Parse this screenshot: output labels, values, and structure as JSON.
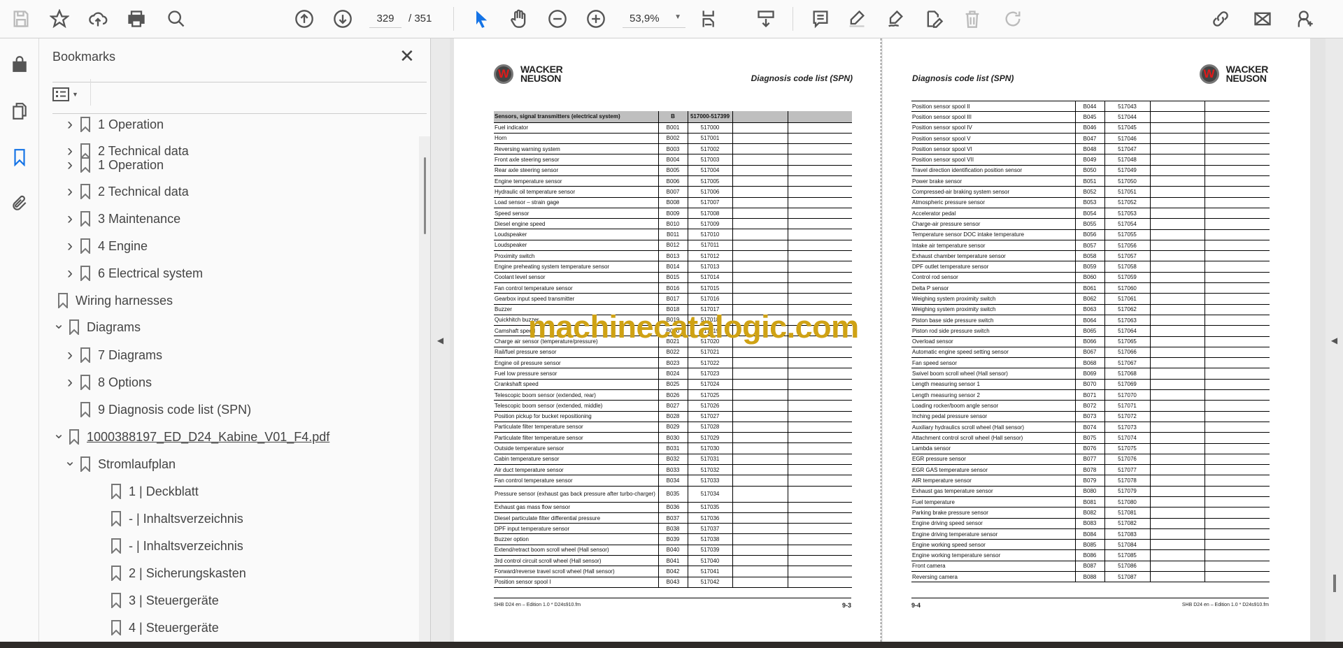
{
  "toolbar": {
    "page_current": "329",
    "page_total": "/ 351",
    "zoom": "53,9%",
    "icons": [
      "save-icon",
      "bookmark-star-icon",
      "upload-cloud-icon",
      "print-icon",
      "find-icon",
      "page-up-icon",
      "page-down-icon",
      "select-pointer-icon",
      "hand-icon",
      "zoom-out-icon",
      "zoom-in-icon",
      "fit-page-icon",
      "scroll-mode-icon",
      "comment-icon",
      "highlight-icon",
      "sign-icon",
      "edit-pdf-icon",
      "delete-icon",
      "rotate-icon",
      "share-link-icon",
      "email-icon",
      "add-user-icon"
    ]
  },
  "sidebar": {
    "title": "Bookmarks",
    "items": [
      {
        "label": "1 Operation",
        "level": 1,
        "state": "collapsed"
      },
      {
        "label": "2 Technical data",
        "level": 1,
        "state": "collapsed"
      },
      {
        "label": "1 Operation",
        "level": 1,
        "state": "collapsed"
      },
      {
        "label": "2 Technical data",
        "level": 1,
        "state": "collapsed"
      },
      {
        "label": "3 Maintenance",
        "level": 1,
        "state": "collapsed"
      },
      {
        "label": "4 Engine",
        "level": 1,
        "state": "collapsed"
      },
      {
        "label": "6 Electrical system",
        "level": 1,
        "state": "collapsed"
      },
      {
        "label": "Wiring harnesses",
        "level": 0,
        "state": "leaf"
      },
      {
        "label": "Diagrams",
        "level": 0,
        "state": "expanded"
      },
      {
        "label": "7 Diagrams",
        "level": 1,
        "state": "collapsed"
      },
      {
        "label": "8 Options",
        "level": 1,
        "state": "collapsed"
      },
      {
        "label": "9 Diagnosis code list (SPN)",
        "level": 1,
        "state": "leaf"
      },
      {
        "label": "1000388197_ED_D24_Kabine_V01_F4.pdf",
        "level": 0,
        "state": "expanded",
        "link": true
      },
      {
        "label": "Stromlaufplan",
        "level": 1,
        "state": "expanded"
      },
      {
        "label": "1 | Deckblatt",
        "level": 2,
        "state": "leaf"
      },
      {
        "label": "- | Inhaltsverzeichnis",
        "level": 2,
        "state": "leaf"
      },
      {
        "label": "- | Inhaltsverzeichnis",
        "level": 2,
        "state": "leaf"
      },
      {
        "label": "2 | Sicherungskasten",
        "level": 2,
        "state": "leaf"
      },
      {
        "label": "3 | Steuergeräte",
        "level": 2,
        "state": "leaf"
      },
      {
        "label": "4 | Steuergeräte",
        "level": 2,
        "state": "leaf"
      }
    ]
  },
  "document": {
    "brand": "WACKER NEUSON",
    "section_title": "Diagnosis code list (SPN)",
    "watermark": "machinecatalogic.com",
    "left_page": {
      "header_row": [
        "Sensors, signal transmitters (electrical system)",
        "B",
        "517000-517399",
        "",
        ""
      ],
      "rows": [
        [
          "Fuel indicator",
          "B001",
          "517000"
        ],
        [
          "Horn",
          "B002",
          "517001"
        ],
        [
          "Reversing warning system",
          "B003",
          "517002"
        ],
        [
          "Front axle steering sensor",
          "B004",
          "517003"
        ],
        [
          "Rear axle steering sensor",
          "B005",
          "517004"
        ],
        [
          "Engine temperature sensor",
          "B006",
          "517005"
        ],
        [
          "Hydraulic oil temperature sensor",
          "B007",
          "517006"
        ],
        [
          "Load sensor – strain gage",
          "B008",
          "517007"
        ],
        [
          "Speed sensor",
          "B009",
          "517008"
        ],
        [
          "Diesel engine speed",
          "B010",
          "517009"
        ],
        [
          "Loudspeaker",
          "B011",
          "517010"
        ],
        [
          "Loudspeaker",
          "B012",
          "517011"
        ],
        [
          "Proximity switch",
          "B013",
          "517012"
        ],
        [
          "Engine preheating system temperature sensor",
          "B014",
          "517013"
        ],
        [
          "Coolant level sensor",
          "B015",
          "517014"
        ],
        [
          "Fan control temperature sensor",
          "B016",
          "517015"
        ],
        [
          "Gearbox input speed transmitter",
          "B017",
          "517016"
        ],
        [
          "Buzzer",
          "B018",
          "517017"
        ],
        [
          "Quickhitch buzzer",
          "B019",
          "517018"
        ],
        [
          "Camshaft speed",
          "B020",
          "517019"
        ],
        [
          "Charge air sensor (temperature/pressure)",
          "B021",
          "517020"
        ],
        [
          "Rail/fuel pressure sensor",
          "B022",
          "517021"
        ],
        [
          "Engine oil pressure sensor",
          "B023",
          "517022"
        ],
        [
          "Fuel low pressure sensor",
          "B024",
          "517023"
        ],
        [
          "Crankshaft speed",
          "B025",
          "517024"
        ],
        [
          "Telescopic boom sensor (extended, rear)",
          "B026",
          "517025"
        ],
        [
          "Telescopic boom sensor (extended, middle)",
          "B027",
          "517026"
        ],
        [
          "Position pickup for bucket repositioning",
          "B028",
          "517027"
        ],
        [
          "Particulate filter temperature sensor",
          "B029",
          "517028"
        ],
        [
          "Particulate filter temperature sensor",
          "B030",
          "517029"
        ],
        [
          "Outside temperature sensor",
          "B031",
          "517030"
        ],
        [
          "Cabin temperature sensor",
          "B032",
          "517031"
        ],
        [
          "Air duct temperature sensor",
          "B033",
          "517032"
        ],
        [
          "Fan control temperature sensor",
          "B034",
          "517033"
        ],
        [
          "Pressure sensor (exhaust gas back pressure after turbo-charger)",
          "B035",
          "517034"
        ],
        [
          "Exhaust gas mass flow sensor",
          "B036",
          "517035"
        ],
        [
          "Diesel particulate filter differential pressure",
          "B037",
          "517036"
        ],
        [
          "DPF input temperature sensor",
          "B038",
          "517037"
        ],
        [
          "Buzzer option",
          "B039",
          "517038"
        ],
        [
          "Extend/retract boom scroll wheel (Hall sensor)",
          "B040",
          "517039"
        ],
        [
          "3rd control circuit scroll wheel (Hall sensor)",
          "B041",
          "517040"
        ],
        [
          "Forward/reverse travel scroll wheel (Hall sensor)",
          "B042",
          "517041"
        ],
        [
          "Position sensor spool I",
          "B043",
          "517042"
        ]
      ],
      "footer_text": "SHB D24 en – Edition 1.0 * D24s910.fm",
      "page_number": "9-3"
    },
    "right_page": {
      "rows": [
        [
          "Position sensor spool II",
          "B044",
          "517043"
        ],
        [
          "Position sensor spool III",
          "B045",
          "517044"
        ],
        [
          "Position sensor spool IV",
          "B046",
          "517045"
        ],
        [
          "Position sensor spool V",
          "B047",
          "517046"
        ],
        [
          "Position sensor spool VI",
          "B048",
          "517047"
        ],
        [
          "Position sensor spool VII",
          "B049",
          "517048"
        ],
        [
          "Travel direction identification position sensor",
          "B050",
          "517049"
        ],
        [
          "Power brake sensor",
          "B051",
          "517050"
        ],
        [
          "Compressed-air braking system sensor",
          "B052",
          "517051"
        ],
        [
          "Atmospheric pressure sensor",
          "B053",
          "517052"
        ],
        [
          "Accelerator pedal",
          "B054",
          "517053"
        ],
        [
          "Charge-air pressure sensor",
          "B055",
          "517054"
        ],
        [
          "Temperature sensor DOC intake temperature",
          "B056",
          "517055"
        ],
        [
          "Intake air temperature sensor",
          "B057",
          "517056"
        ],
        [
          "Exhaust chamber temperature sensor",
          "B058",
          "517057"
        ],
        [
          "DPF outlet temperature sensor",
          "B059",
          "517058"
        ],
        [
          "Control rod sensor",
          "B060",
          "517059"
        ],
        [
          "Delta P sensor",
          "B061",
          "517060"
        ],
        [
          "Weighing system proximity switch",
          "B062",
          "517061"
        ],
        [
          "Weighing system proximity switch",
          "B063",
          "517062"
        ],
        [
          "Piston base side pressure switch",
          "B064",
          "517063"
        ],
        [
          "Piston rod side pressure switch",
          "B065",
          "517064"
        ],
        [
          "Overload sensor",
          "B066",
          "517065"
        ],
        [
          "Automatic engine speed setting sensor",
          "B067",
          "517066"
        ],
        [
          "Fan speed sensor",
          "B068",
          "517067"
        ],
        [
          "Swivel boom scroll wheel (Hall sensor)",
          "B069",
          "517068"
        ],
        [
          "Length measuring sensor 1",
          "B070",
          "517069"
        ],
        [
          "Length measuring sensor 2",
          "B071",
          "517070"
        ],
        [
          "Loading rocker/boom angle sensor",
          "B072",
          "517071"
        ],
        [
          "Inching pedal pressure sensor",
          "B073",
          "517072"
        ],
        [
          "Auxiliary hydraulics scroll wheel (Hall sensor)",
          "B074",
          "517073"
        ],
        [
          "Attachment control scroll wheel (Hall sensor)",
          "B075",
          "517074"
        ],
        [
          "Lambda sensor",
          "B076",
          "517075"
        ],
        [
          "EGR pressure sensor",
          "B077",
          "517076"
        ],
        [
          "EGR GAS temperature sensor",
          "B078",
          "517077"
        ],
        [
          "AIR temperature sensor",
          "B079",
          "517078"
        ],
        [
          "Exhaust gas temperature sensor",
          "B080",
          "517079"
        ],
        [
          "Fuel temperature",
          "B081",
          "517080"
        ],
        [
          "Parking brake pressure sensor",
          "B082",
          "517081"
        ],
        [
          "Engine driving speed sensor",
          "B083",
          "517082"
        ],
        [
          "Engine driving temperature sensor",
          "B084",
          "517083"
        ],
        [
          "Engine working speed sensor",
          "B085",
          "517084"
        ],
        [
          "Engine working temperature sensor",
          "B086",
          "517085"
        ],
        [
          "Front camera",
          "B087",
          "517086"
        ],
        [
          "Reversing camera",
          "B088",
          "517087"
        ]
      ],
      "footer_text": "SHB D24 en – Edition 1.0 * D24s910.fm",
      "page_number": "9-4"
    }
  },
  "colors": {
    "accent": "#1473e6",
    "watermark": "#cfa214",
    "table_header": "#bfbfbf"
  }
}
